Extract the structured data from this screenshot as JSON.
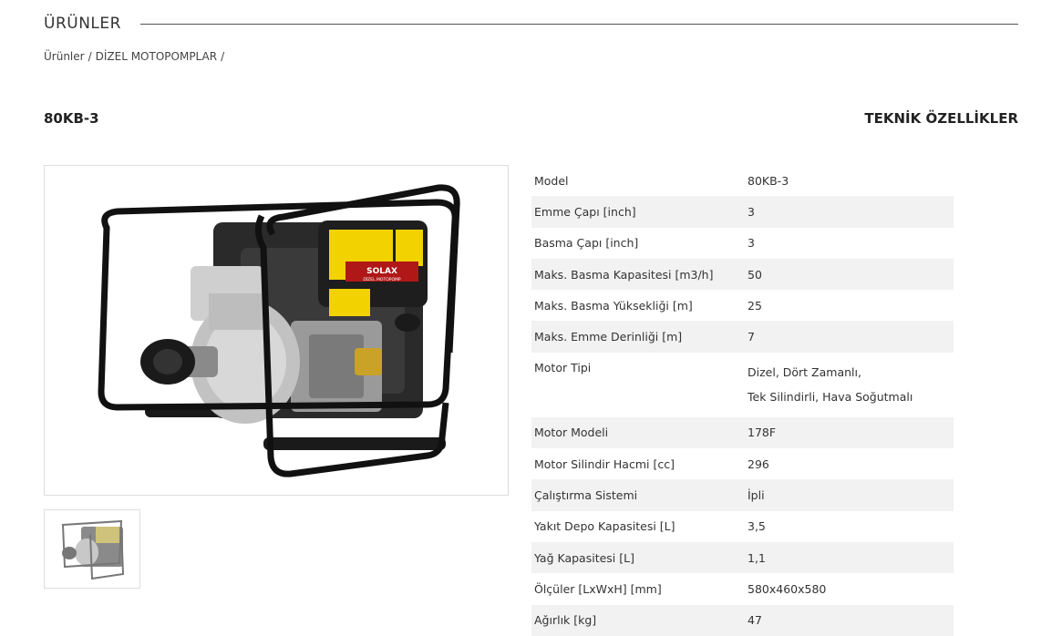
{
  "section": {
    "title": "ÜRÜNLER"
  },
  "breadcrumb": {
    "items": [
      "Ürünler",
      "DİZEL MOTOPOMPLAR"
    ],
    "separator": "/"
  },
  "product": {
    "name": "80KB-3",
    "specs_title": "TEKNİK ÖZELLİKLER",
    "image_brand": "SOLAX",
    "image_subtitle": "DİZEL MOTOPOMP",
    "specs": [
      {
        "key": "Model",
        "value": "80KB-3"
      },
      {
        "key": "Emme Çapı [inch]",
        "value": "3"
      },
      {
        "key": "Basma Çapı [inch]",
        "value": "3"
      },
      {
        "key": "Maks. Basma Kapasitesi [m3/h]",
        "value": "50"
      },
      {
        "key": "Maks. Basma Yüksekliği [m]",
        "value": "25"
      },
      {
        "key": "Maks. Emme Derinliği [m]",
        "value": "7"
      },
      {
        "key": "Motor Tipi",
        "value_lines": [
          "Dizel, Dört Zamanlı,",
          "Tek Silindirli, Hava Soğutmalı"
        ]
      },
      {
        "key": "Motor Modeli",
        "value": "178F"
      },
      {
        "key": "Motor Silindir Hacmi [cc]",
        "value": "296"
      },
      {
        "key": "Çalıştırma Sistemi",
        "value": "İpli"
      },
      {
        "key": "Yakıt Depo Kapasitesi [L]",
        "value": "3,5"
      },
      {
        "key": "Yağ Kapasitesi [L]",
        "value": "1,1"
      },
      {
        "key": "Ölçüler [LxWxH] [mm]",
        "value": "580x460x580"
      },
      {
        "key": "Ağırlık [kg]",
        "value": "47"
      }
    ]
  },
  "colors": {
    "frame": "#111111",
    "pump_body": "#c8c8c8",
    "engine": "#2a2a2a",
    "label": "#f2d200",
    "brand_panel": "#b01818",
    "row_alt": "#f2f2f2"
  }
}
